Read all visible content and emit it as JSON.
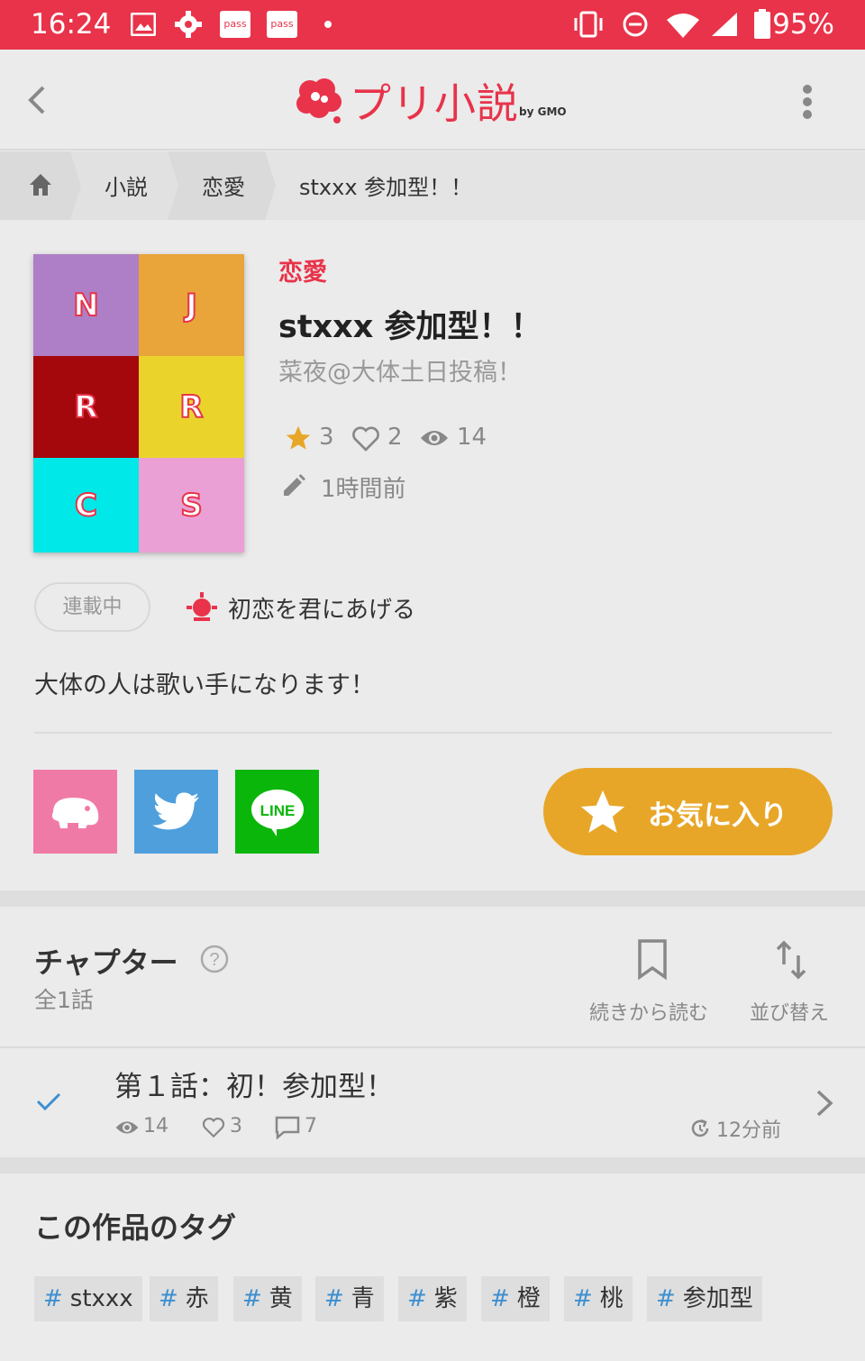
{
  "status_bar": {
    "time": "16:24",
    "battery": "95%",
    "notif_1": "pass",
    "notif_2": "pass"
  },
  "app_bar": {
    "logo": "プリ小説",
    "logo_suffix": "by GMO"
  },
  "breadcrumb": {
    "items": [
      "小説",
      "恋愛",
      "stxxx 参加型！！"
    ]
  },
  "cover": {
    "letters": [
      "N",
      "J",
      "R",
      "R",
      "C",
      "S"
    ],
    "colors": [
      "#ae7fc6",
      "#e9a43a",
      "#a5080c",
      "#ead42c",
      "#00e8e8",
      "#eaa0d4"
    ]
  },
  "story": {
    "genre": "恋愛",
    "title": "stxxx 参加型！！",
    "author": "菜夜@大体土日投稿！",
    "stars": "3",
    "likes": "2",
    "views": "14",
    "updated": "1時間前",
    "status": "連載中",
    "award": "初恋を君にあげる",
    "description": "大体の人は歌い手になります！"
  },
  "actions": {
    "favorite_label": "お気に入り",
    "share_line": "LINE"
  },
  "chapters": {
    "heading": "チャプター",
    "count": "全1話",
    "continue_label": "続きから読む",
    "sort_label": "並び替え",
    "episodes": [
      {
        "title": "第１話：初！参加型！",
        "views": "14",
        "likes": "3",
        "comments": "7",
        "time": "12分前"
      }
    ]
  },
  "tags": {
    "heading": "この作品のタグ",
    "items": [
      "stxxx",
      "赤",
      "黄",
      "青",
      "紫",
      "橙",
      "桃",
      "参加型"
    ]
  },
  "colors": {
    "accent": "#e8334a",
    "favorite": "#e8a628",
    "twitter": "#4e9fdc",
    "line": "#0ab60a",
    "prism": "#f07aa6"
  }
}
